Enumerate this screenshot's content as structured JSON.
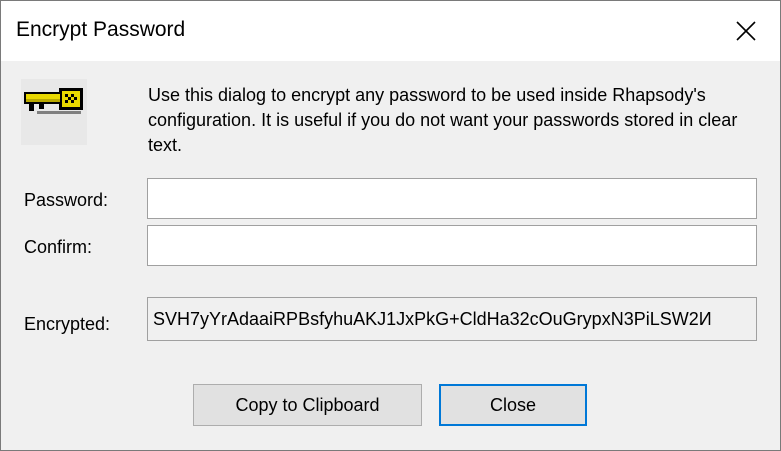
{
  "window": {
    "title": "Encrypt Password"
  },
  "icons": {
    "close": "close-x-icon",
    "key": "key-icon"
  },
  "description": "Use this dialog to encrypt any password to be used inside Rhapsody's configuration. It is useful if you do not want your passwords stored in clear text.",
  "form": {
    "password_label": "Password:",
    "password_value": "",
    "confirm_label": "Confirm:",
    "confirm_value": "",
    "encrypted_label": "Encrypted:",
    "encrypted_value": "SVH7yYrAdaaiRPBsfyhuAKJ1JxPkG+CldHa32cOuGrypxN3PiLSW2И"
  },
  "buttons": {
    "copy_label": "Copy to Clipboard",
    "close_label": "Close"
  },
  "colors": {
    "accent": "#0078d7",
    "key_gold": "#e8d800"
  }
}
